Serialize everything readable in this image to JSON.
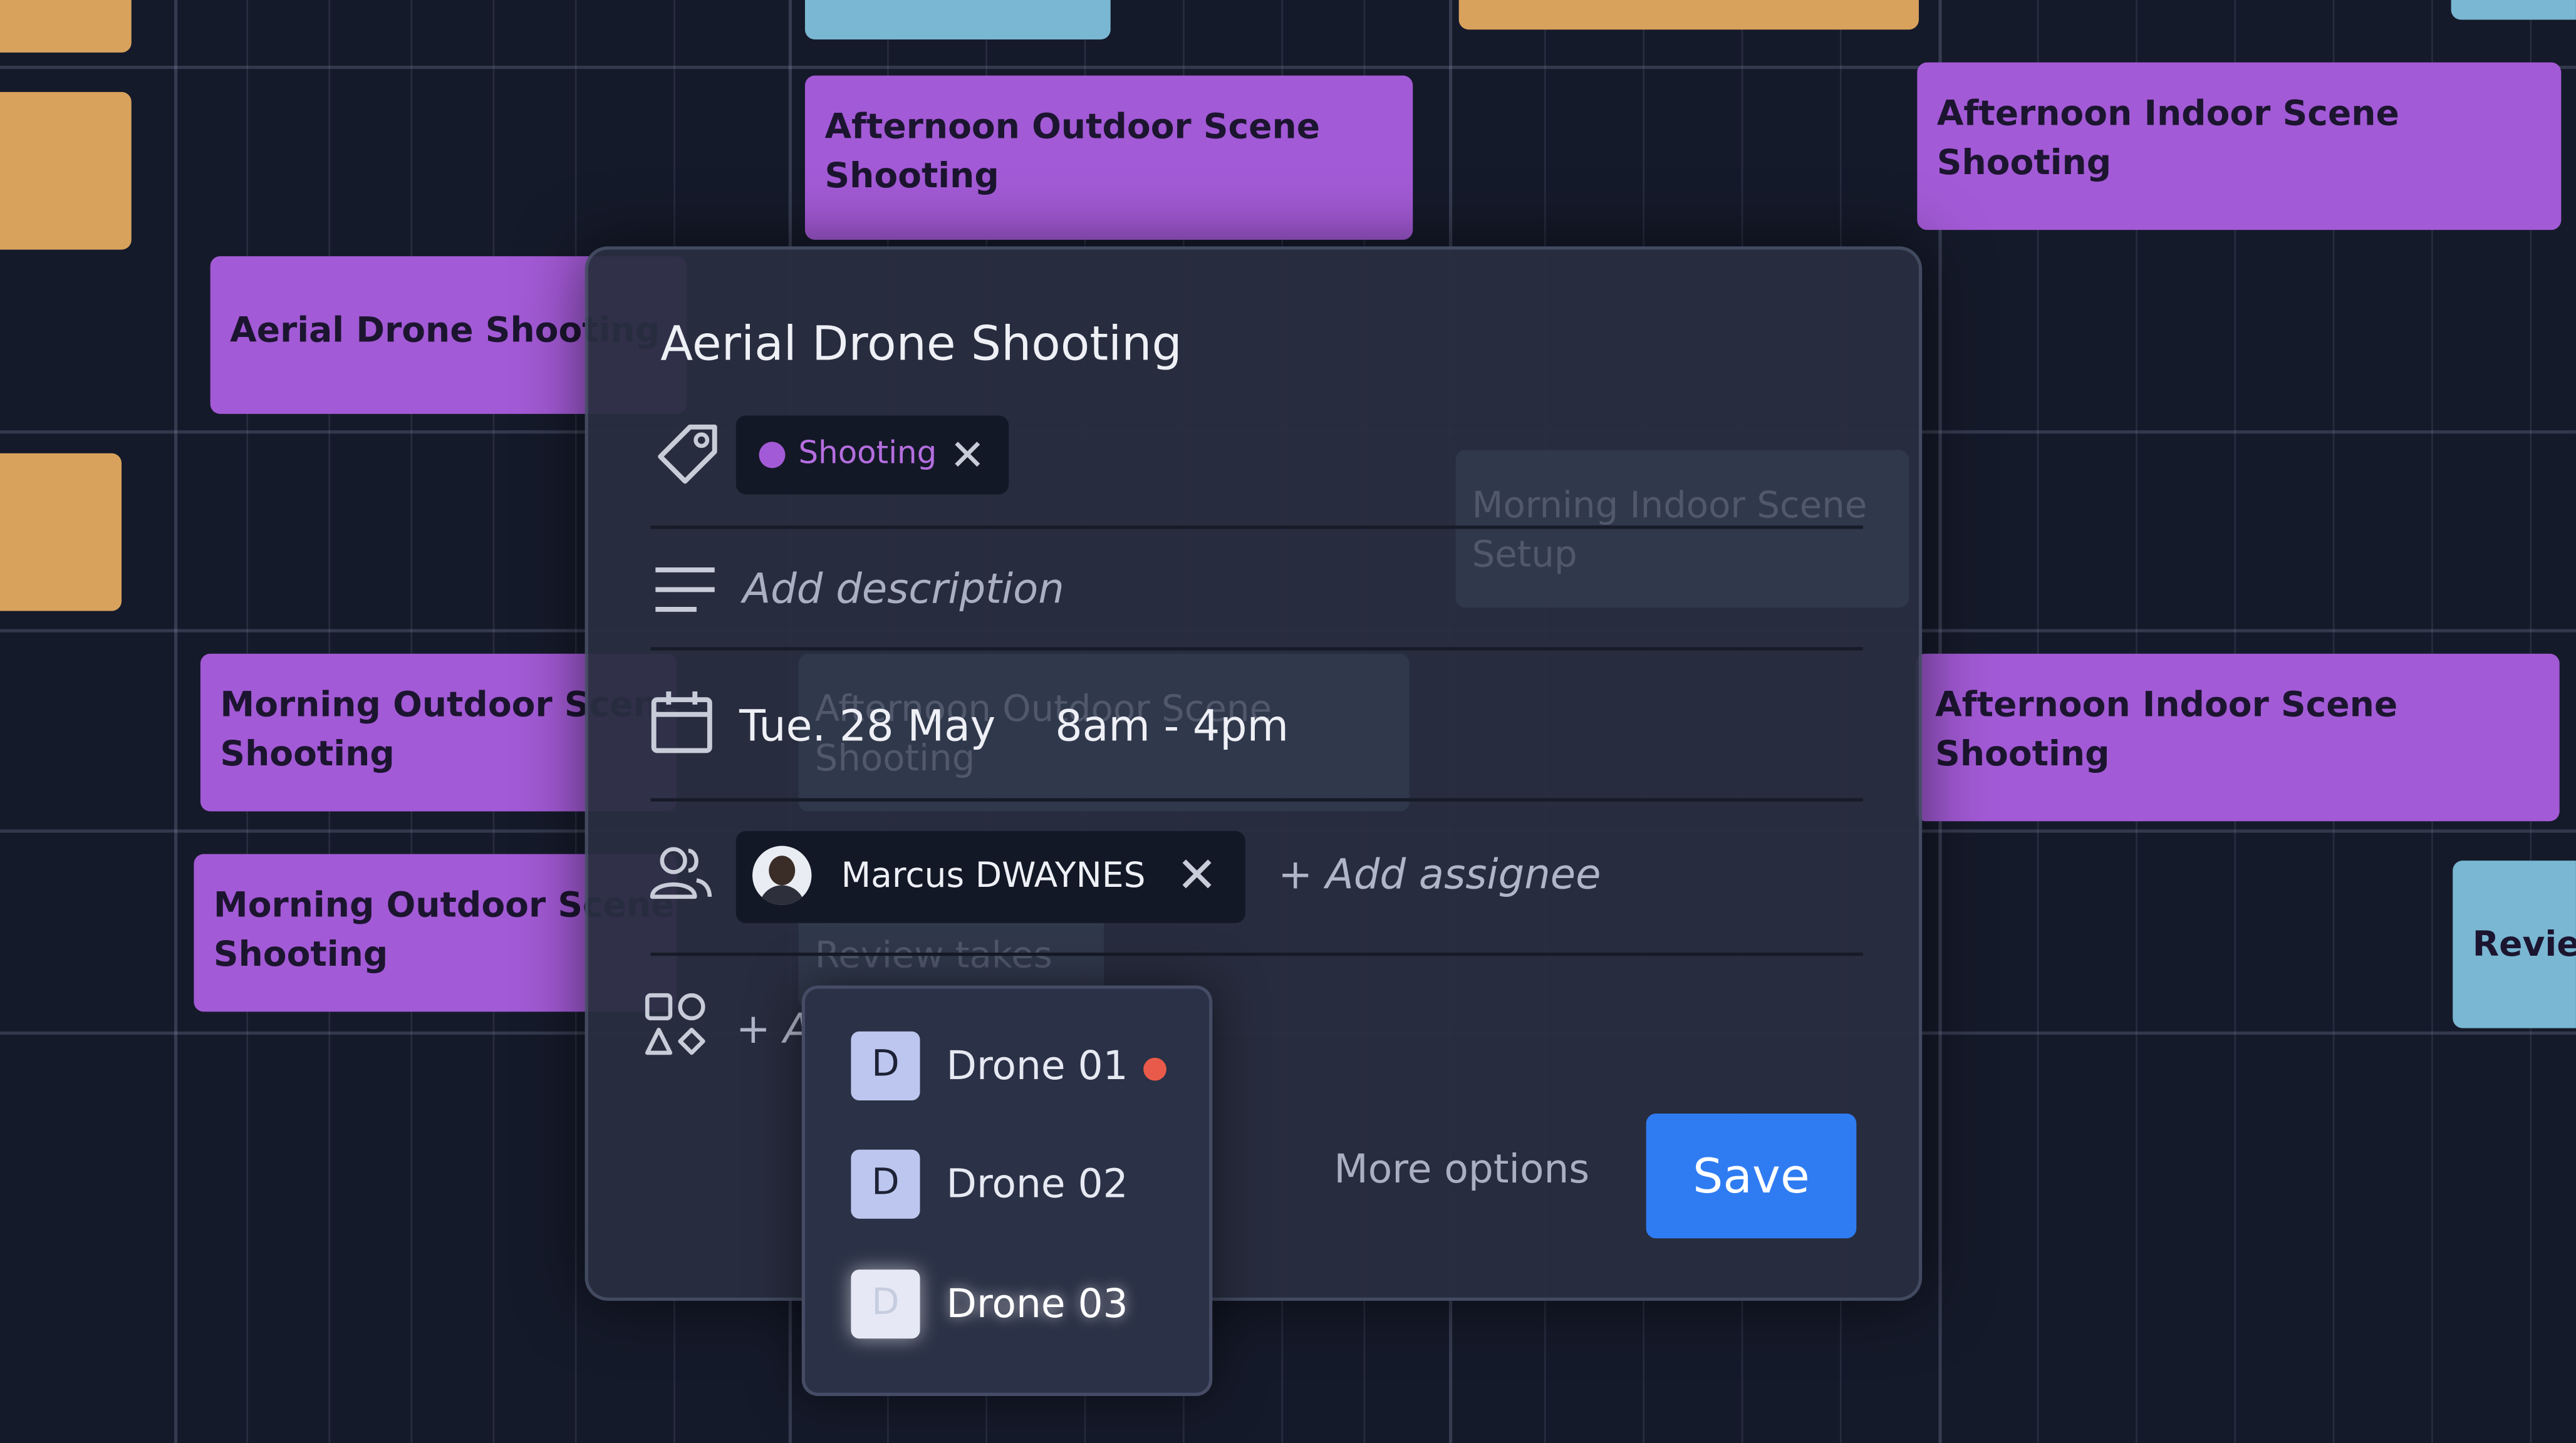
{
  "calendar": {
    "events": {
      "afternoon_outdoor_1": {
        "line1": "Afternoon Outdoor Scene",
        "line2": "Shooting"
      },
      "afternoon_indoor_1": {
        "line1": "Afternoon Indoor Scene",
        "line2": "Shooting"
      },
      "aerial_drone": {
        "line1": "Aerial Drone Shooting"
      },
      "morning_outdoor_1": {
        "line1": "Morning Outdoor Scene",
        "line2": "Shooting"
      },
      "morning_outdoor_2": {
        "line1": "Morning Outdoor Scene",
        "line2": "Shooting"
      },
      "afternoon_indoor_2": {
        "line1": "Afternoon Indoor Scene",
        "line2": "Shooting"
      },
      "review": {
        "line1": "Review takes"
      },
      "ghost_indoor_setup": {
        "line1": "Morning Indoor Scene",
        "line2": "Setup"
      },
      "ghost_outdoor": {
        "line1": "Afternoon Outdoor Scene",
        "line2": "Shooting"
      },
      "ghost_review": {
        "line1": "Review takes"
      }
    }
  },
  "dialog": {
    "title": "Aerial Drone Shooting",
    "tag": {
      "label": "Shooting",
      "color": "#a35ad6"
    },
    "description_placeholder": "Add description",
    "date": "Tue. 28 May",
    "time_range": "8am  -  4pm",
    "assignee": {
      "name": "Marcus DWAYNES"
    },
    "add_assignee_label": "+ Add assignee",
    "add_resource_label": "+ Add resource",
    "more_options_label": "More options",
    "save_label": "Save"
  },
  "dropdown": {
    "options": [
      {
        "badge": "D",
        "label": "Drone 01",
        "status_dot": "#ea5a4a"
      },
      {
        "badge": "D",
        "label": "Drone 02"
      },
      {
        "badge": "D",
        "label": "Drone 03"
      }
    ]
  },
  "colors": {
    "background": "#151a2a",
    "event_purple": "#a35ad6",
    "event_orange": "#d8a25c",
    "event_blue": "#79b7d2",
    "save_button": "#2f7cf2"
  }
}
